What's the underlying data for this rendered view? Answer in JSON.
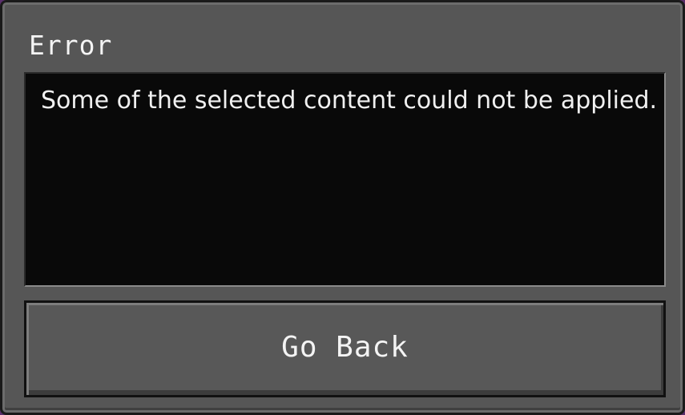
{
  "dialog": {
    "title": "Error",
    "message": "Some of the selected content could not be applied.",
    "back_button_label": "Go Back"
  }
}
